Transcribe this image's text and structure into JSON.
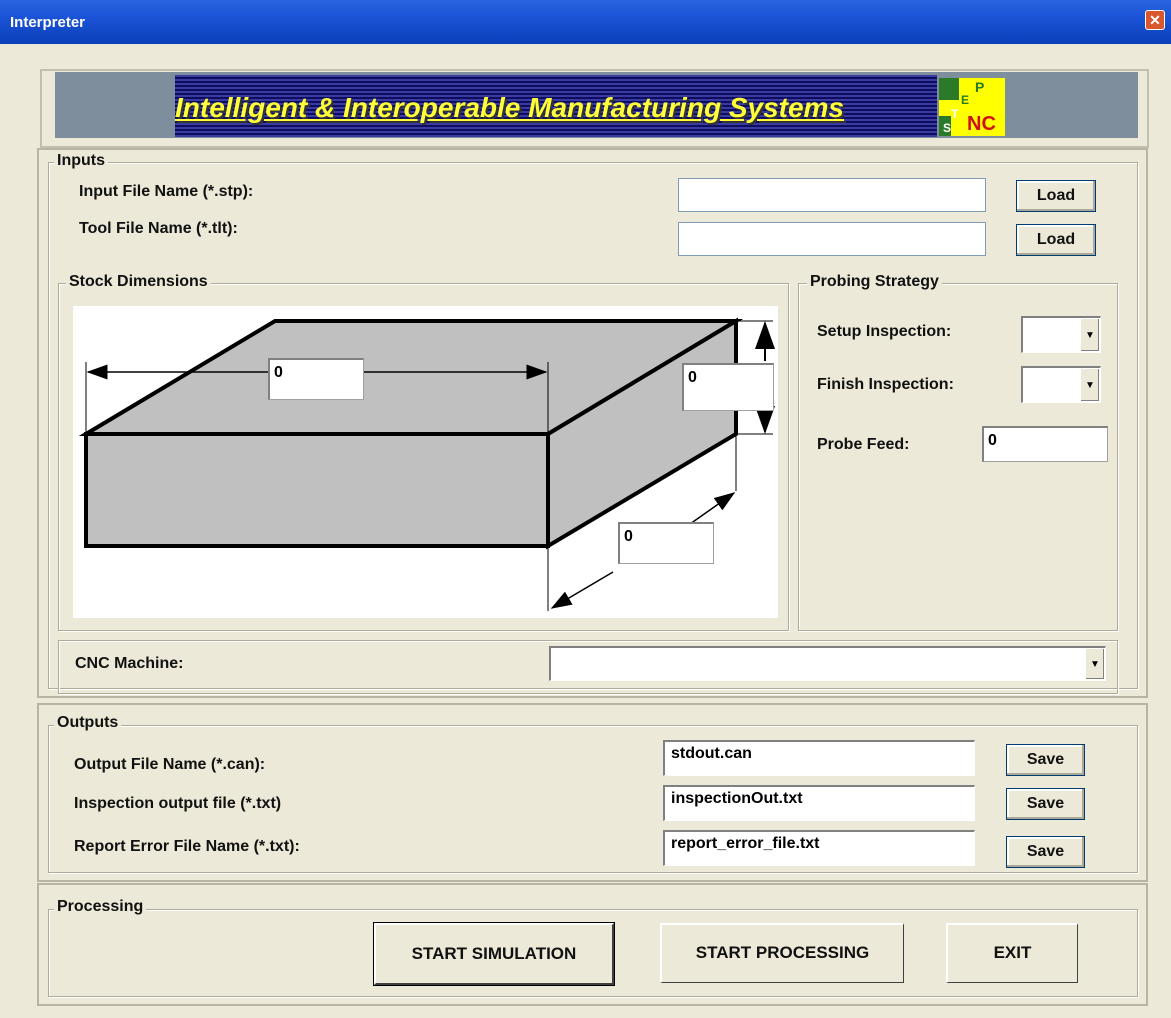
{
  "window": {
    "title": "Interpreter",
    "close_glyph": "✕"
  },
  "banner": {
    "text": "Intelligent & Interoperable Manufacturing Systems",
    "logo_letters": [
      "S",
      "T",
      "E",
      "P",
      "NC"
    ],
    "colors": {
      "text": "#ffff3a",
      "background": "#7e8e9c",
      "stripes": "#1a1a80"
    }
  },
  "inputs": {
    "legend": "Inputs",
    "input_file_label": "Input File Name (*.stp):",
    "input_file_value": "",
    "tool_file_label": "Tool File Name (*.tlt):",
    "tool_file_value": "",
    "load_label": "Load"
  },
  "stock": {
    "legend": "Stock Dimensions",
    "length_value": "0",
    "height_value": "0",
    "width_value": "0"
  },
  "probing": {
    "legend": "Probing Strategy",
    "setup_label": "Setup Inspection:",
    "setup_value": "",
    "finish_label": "Finish Inspection:",
    "finish_value": "",
    "feed_label": "Probe Feed:",
    "feed_value": "0"
  },
  "cnc": {
    "label": "CNC Machine:",
    "value": ""
  },
  "outputs": {
    "legend": "Outputs",
    "output_file_label": "Output File Name (*.can):",
    "output_file_value": "stdout.can",
    "inspection_label": "Inspection output file (*.txt)",
    "inspection_value": "inspectionOut.txt",
    "report_label": "Report Error File Name (*.txt):",
    "report_value": "report_error_file.txt",
    "save_label": "Save"
  },
  "processing": {
    "legend": "Processing",
    "start_simulation": "START SIMULATION",
    "start_processing": "START PROCESSING",
    "exit": "EXIT"
  },
  "icons": {
    "dropdown": "chevron-down-icon",
    "close": "close-icon"
  }
}
